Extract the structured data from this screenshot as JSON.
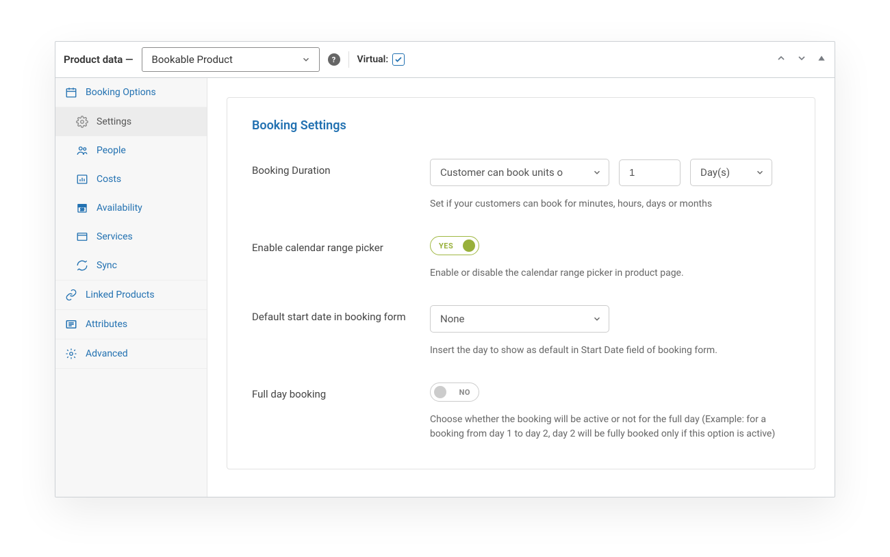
{
  "header": {
    "title": "Product data —",
    "product_type": "Bookable Product",
    "virtual_label": "Virtual:",
    "virtual_checked": true
  },
  "sidebar": {
    "booking_options": "Booking Options",
    "subs": {
      "settings": "Settings",
      "people": "People",
      "costs": "Costs",
      "availability": "Availability",
      "services": "Services",
      "sync": "Sync"
    },
    "linked_products": "Linked Products",
    "attributes": "Attributes",
    "advanced": "Advanced"
  },
  "content": {
    "section_title": "Booking Settings",
    "duration": {
      "label": "Booking Duration",
      "type_value": "Customer can book units o",
      "qty_value": "1",
      "unit_value": "Day(s)",
      "help": "Set if your customers can book for minutes, hours, days or months"
    },
    "range_picker": {
      "label": "Enable calendar range picker",
      "toggle_label": "YES",
      "help": "Enable or disable the calendar range picker in product page."
    },
    "default_start": {
      "label": "Default start date in booking form",
      "value": "None",
      "help": "Insert the day to show as default in Start Date field of booking form."
    },
    "full_day": {
      "label": "Full day booking",
      "toggle_label": "NO",
      "help": "Choose whether the booking will be active or not for the full day (Example: for a booking from day 1 to day 2, day 2 will be fully booked only if this option is active)"
    }
  }
}
